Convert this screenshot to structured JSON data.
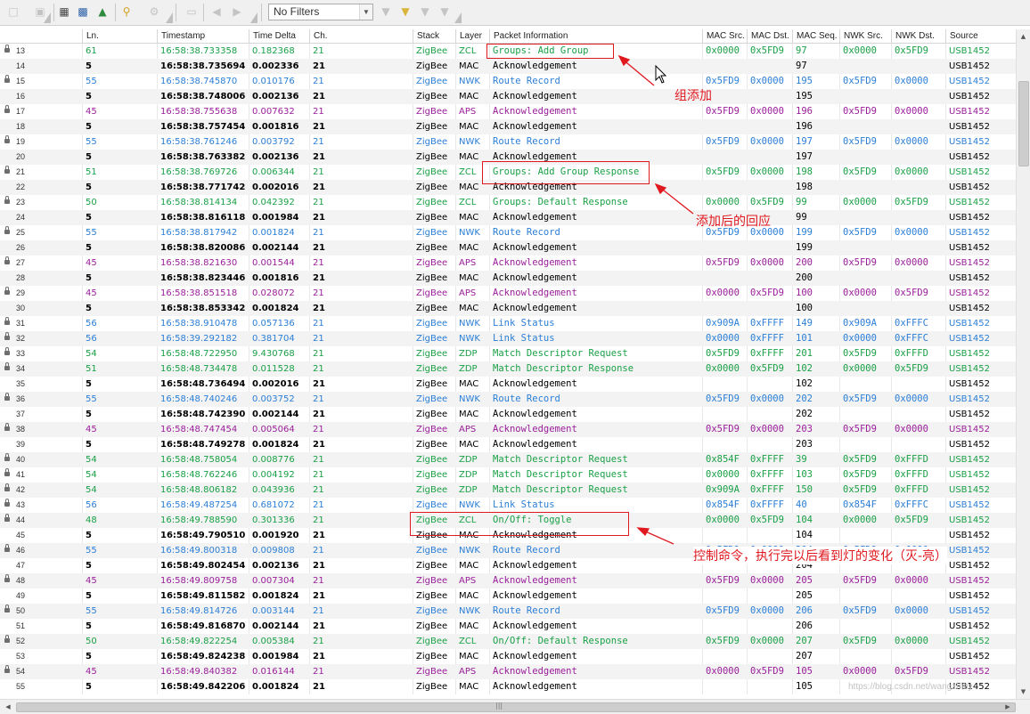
{
  "toolbar": {
    "filter_value": "No Filters",
    "icons": [
      "new-capture-icon",
      "save-icon",
      "device-list-icon",
      "capture-icon",
      "export-icon",
      "decryption-key-icon",
      "settings-gear-icon",
      "clear-icon",
      "go-back-icon",
      "go-forward-icon",
      "filter-icon",
      "filter-apply-icon",
      "filter-clear-icon",
      "filter-options-icon"
    ]
  },
  "columns": [
    "Ln.",
    "Timestamp",
    "Time Delta",
    "Ch.",
    "Stack",
    "Layer",
    "Packet Information",
    "MAC Src.",
    "MAC Dst.",
    "MAC Seq.",
    "NWK Src.",
    "NWK Dst.",
    "Source"
  ],
  "colors": {
    "green": "#1aa046",
    "blue": "#2b7ed6",
    "purple": "#9a1e9a",
    "black": "#000000",
    "annotation_red": "#e0191f",
    "odd_row": "#f3f3f3"
  },
  "packets": [
    {
      "seq": "13",
      "lock": true,
      "color": "green",
      "ln": "61",
      "ts": "16:58:38.733358",
      "delta": "0.182368",
      "ch": "21",
      "stack": "ZigBee",
      "layer": "ZCL",
      "info": "Groups: Add Group",
      "mac_src": "0x0000",
      "mac_dst": "0x5FD9",
      "mac_seq": "97",
      "nwk_src": "0x0000",
      "nwk_dst": "0x5FD9",
      "source": "USB1452"
    },
    {
      "seq": "14",
      "lock": false,
      "color": "black",
      "ln": "5",
      "ts": "16:58:38.735694",
      "delta": "0.002336",
      "ch": "21",
      "stack": "ZigBee",
      "layer": "MAC",
      "info": "Acknowledgement",
      "mac_src": "",
      "mac_dst": "",
      "mac_seq": "97",
      "nwk_src": "",
      "nwk_dst": "",
      "source": "USB1452"
    },
    {
      "seq": "15",
      "lock": true,
      "color": "blue",
      "ln": "55",
      "ts": "16:58:38.745870",
      "delta": "0.010176",
      "ch": "21",
      "stack": "ZigBee",
      "layer": "NWK",
      "info": "Route Record",
      "mac_src": "0x5FD9",
      "mac_dst": "0x0000",
      "mac_seq": "195",
      "nwk_src": "0x5FD9",
      "nwk_dst": "0x0000",
      "source": "USB1452"
    },
    {
      "seq": "16",
      "lock": false,
      "color": "black",
      "ln": "5",
      "ts": "16:58:38.748006",
      "delta": "0.002136",
      "ch": "21",
      "stack": "ZigBee",
      "layer": "MAC",
      "info": "Acknowledgement",
      "mac_src": "",
      "mac_dst": "",
      "mac_seq": "195",
      "nwk_src": "",
      "nwk_dst": "",
      "source": "USB1452"
    },
    {
      "seq": "17",
      "lock": true,
      "color": "purple",
      "ln": "45",
      "ts": "16:58:38.755638",
      "delta": "0.007632",
      "ch": "21",
      "stack": "ZigBee",
      "layer": "APS",
      "info": "Acknowledgement",
      "mac_src": "0x5FD9",
      "mac_dst": "0x0000",
      "mac_seq": "196",
      "nwk_src": "0x5FD9",
      "nwk_dst": "0x0000",
      "source": "USB1452"
    },
    {
      "seq": "18",
      "lock": false,
      "color": "black",
      "ln": "5",
      "ts": "16:58:38.757454",
      "delta": "0.001816",
      "ch": "21",
      "stack": "ZigBee",
      "layer": "MAC",
      "info": "Acknowledgement",
      "mac_src": "",
      "mac_dst": "",
      "mac_seq": "196",
      "nwk_src": "",
      "nwk_dst": "",
      "source": "USB1452"
    },
    {
      "seq": "19",
      "lock": true,
      "color": "blue",
      "ln": "55",
      "ts": "16:58:38.761246",
      "delta": "0.003792",
      "ch": "21",
      "stack": "ZigBee",
      "layer": "NWK",
      "info": "Route Record",
      "mac_src": "0x5FD9",
      "mac_dst": "0x0000",
      "mac_seq": "197",
      "nwk_src": "0x5FD9",
      "nwk_dst": "0x0000",
      "source": "USB1452"
    },
    {
      "seq": "20",
      "lock": false,
      "color": "black",
      "ln": "5",
      "ts": "16:58:38.763382",
      "delta": "0.002136",
      "ch": "21",
      "stack": "ZigBee",
      "layer": "MAC",
      "info": "Acknowledgement",
      "mac_src": "",
      "mac_dst": "",
      "mac_seq": "197",
      "nwk_src": "",
      "nwk_dst": "",
      "source": "USB1452"
    },
    {
      "seq": "21",
      "lock": true,
      "color": "green",
      "ln": "51",
      "ts": "16:58:38.769726",
      "delta": "0.006344",
      "ch": "21",
      "stack": "ZigBee",
      "layer": "ZCL",
      "info": "Groups: Add Group Response",
      "mac_src": "0x5FD9",
      "mac_dst": "0x0000",
      "mac_seq": "198",
      "nwk_src": "0x5FD9",
      "nwk_dst": "0x0000",
      "source": "USB1452"
    },
    {
      "seq": "22",
      "lock": false,
      "color": "black",
      "ln": "5",
      "ts": "16:58:38.771742",
      "delta": "0.002016",
      "ch": "21",
      "stack": "ZigBee",
      "layer": "MAC",
      "info": "Acknowledgement",
      "mac_src": "",
      "mac_dst": "",
      "mac_seq": "198",
      "nwk_src": "",
      "nwk_dst": "",
      "source": "USB1452"
    },
    {
      "seq": "23",
      "lock": true,
      "color": "green",
      "ln": "50",
      "ts": "16:58:38.814134",
      "delta": "0.042392",
      "ch": "21",
      "stack": "ZigBee",
      "layer": "ZCL",
      "info": "Groups: Default Response",
      "mac_src": "0x0000",
      "mac_dst": "0x5FD9",
      "mac_seq": "99",
      "nwk_src": "0x0000",
      "nwk_dst": "0x5FD9",
      "source": "USB1452"
    },
    {
      "seq": "24",
      "lock": false,
      "color": "black",
      "ln": "5",
      "ts": "16:58:38.816118",
      "delta": "0.001984",
      "ch": "21",
      "stack": "ZigBee",
      "layer": "MAC",
      "info": "Acknowledgement",
      "mac_src": "",
      "mac_dst": "",
      "mac_seq": "99",
      "nwk_src": "",
      "nwk_dst": "",
      "source": "USB1452"
    },
    {
      "seq": "25",
      "lock": true,
      "color": "blue",
      "ln": "55",
      "ts": "16:58:38.817942",
      "delta": "0.001824",
      "ch": "21",
      "stack": "ZigBee",
      "layer": "NWK",
      "info": "Route Record",
      "mac_src": "0x5FD9",
      "mac_dst": "0x0000",
      "mac_seq": "199",
      "nwk_src": "0x5FD9",
      "nwk_dst": "0x0000",
      "source": "USB1452"
    },
    {
      "seq": "26",
      "lock": false,
      "color": "black",
      "ln": "5",
      "ts": "16:58:38.820086",
      "delta": "0.002144",
      "ch": "21",
      "stack": "ZigBee",
      "layer": "MAC",
      "info": "Acknowledgement",
      "mac_src": "",
      "mac_dst": "",
      "mac_seq": "199",
      "nwk_src": "",
      "nwk_dst": "",
      "source": "USB1452"
    },
    {
      "seq": "27",
      "lock": true,
      "color": "purple",
      "ln": "45",
      "ts": "16:58:38.821630",
      "delta": "0.001544",
      "ch": "21",
      "stack": "ZigBee",
      "layer": "APS",
      "info": "Acknowledgement",
      "mac_src": "0x5FD9",
      "mac_dst": "0x0000",
      "mac_seq": "200",
      "nwk_src": "0x5FD9",
      "nwk_dst": "0x0000",
      "source": "USB1452"
    },
    {
      "seq": "28",
      "lock": false,
      "color": "black",
      "ln": "5",
      "ts": "16:58:38.823446",
      "delta": "0.001816",
      "ch": "21",
      "stack": "ZigBee",
      "layer": "MAC",
      "info": "Acknowledgement",
      "mac_src": "",
      "mac_dst": "",
      "mac_seq": "200",
      "nwk_src": "",
      "nwk_dst": "",
      "source": "USB1452"
    },
    {
      "seq": "29",
      "lock": true,
      "color": "purple",
      "ln": "45",
      "ts": "16:58:38.851518",
      "delta": "0.028072",
      "ch": "21",
      "stack": "ZigBee",
      "layer": "APS",
      "info": "Acknowledgement",
      "mac_src": "0x0000",
      "mac_dst": "0x5FD9",
      "mac_seq": "100",
      "nwk_src": "0x0000",
      "nwk_dst": "0x5FD9",
      "source": "USB1452"
    },
    {
      "seq": "30",
      "lock": false,
      "color": "black",
      "ln": "5",
      "ts": "16:58:38.853342",
      "delta": "0.001824",
      "ch": "21",
      "stack": "ZigBee",
      "layer": "MAC",
      "info": "Acknowledgement",
      "mac_src": "",
      "mac_dst": "",
      "mac_seq": "100",
      "nwk_src": "",
      "nwk_dst": "",
      "source": "USB1452"
    },
    {
      "seq": "31",
      "lock": true,
      "color": "blue",
      "ln": "56",
      "ts": "16:58:38.910478",
      "delta": "0.057136",
      "ch": "21",
      "stack": "ZigBee",
      "layer": "NWK",
      "info": "Link Status",
      "mac_src": "0x909A",
      "mac_dst": "0xFFFF",
      "mac_seq": "149",
      "nwk_src": "0x909A",
      "nwk_dst": "0xFFFC",
      "source": "USB1452"
    },
    {
      "seq": "32",
      "lock": true,
      "color": "blue",
      "ln": "56",
      "ts": "16:58:39.292182",
      "delta": "0.381704",
      "ch": "21",
      "stack": "ZigBee",
      "layer": "NWK",
      "info": "Link Status",
      "mac_src": "0x0000",
      "mac_dst": "0xFFFF",
      "mac_seq": "101",
      "nwk_src": "0x0000",
      "nwk_dst": "0xFFFC",
      "source": "USB1452"
    },
    {
      "seq": "33",
      "lock": true,
      "color": "green",
      "ln": "54",
      "ts": "16:58:48.722950",
      "delta": "9.430768",
      "ch": "21",
      "stack": "ZigBee",
      "layer": "ZDP",
      "info": "Match Descriptor Request",
      "mac_src": "0x5FD9",
      "mac_dst": "0xFFFF",
      "mac_seq": "201",
      "nwk_src": "0x5FD9",
      "nwk_dst": "0xFFFD",
      "source": "USB1452"
    },
    {
      "seq": "34",
      "lock": true,
      "color": "green",
      "ln": "51",
      "ts": "16:58:48.734478",
      "delta": "0.011528",
      "ch": "21",
      "stack": "ZigBee",
      "layer": "ZDP",
      "info": "Match Descriptor Response",
      "mac_src": "0x0000",
      "mac_dst": "0x5FD9",
      "mac_seq": "102",
      "nwk_src": "0x0000",
      "nwk_dst": "0x5FD9",
      "source": "USB1452"
    },
    {
      "seq": "35",
      "lock": false,
      "color": "black",
      "ln": "5",
      "ts": "16:58:48.736494",
      "delta": "0.002016",
      "ch": "21",
      "stack": "ZigBee",
      "layer": "MAC",
      "info": "Acknowledgement",
      "mac_src": "",
      "mac_dst": "",
      "mac_seq": "102",
      "nwk_src": "",
      "nwk_dst": "",
      "source": "USB1452"
    },
    {
      "seq": "36",
      "lock": true,
      "color": "blue",
      "ln": "55",
      "ts": "16:58:48.740246",
      "delta": "0.003752",
      "ch": "21",
      "stack": "ZigBee",
      "layer": "NWK",
      "info": "Route Record",
      "mac_src": "0x5FD9",
      "mac_dst": "0x0000",
      "mac_seq": "202",
      "nwk_src": "0x5FD9",
      "nwk_dst": "0x0000",
      "source": "USB1452"
    },
    {
      "seq": "37",
      "lock": false,
      "color": "black",
      "ln": "5",
      "ts": "16:58:48.742390",
      "delta": "0.002144",
      "ch": "21",
      "stack": "ZigBee",
      "layer": "MAC",
      "info": "Acknowledgement",
      "mac_src": "",
      "mac_dst": "",
      "mac_seq": "202",
      "nwk_src": "",
      "nwk_dst": "",
      "source": "USB1452"
    },
    {
      "seq": "38",
      "lock": true,
      "color": "purple",
      "ln": "45",
      "ts": "16:58:48.747454",
      "delta": "0.005064",
      "ch": "21",
      "stack": "ZigBee",
      "layer": "APS",
      "info": "Acknowledgement",
      "mac_src": "0x5FD9",
      "mac_dst": "0x0000",
      "mac_seq": "203",
      "nwk_src": "0x5FD9",
      "nwk_dst": "0x0000",
      "source": "USB1452"
    },
    {
      "seq": "39",
      "lock": false,
      "color": "black",
      "ln": "5",
      "ts": "16:58:48.749278",
      "delta": "0.001824",
      "ch": "21",
      "stack": "ZigBee",
      "layer": "MAC",
      "info": "Acknowledgement",
      "mac_src": "",
      "mac_dst": "",
      "mac_seq": "203",
      "nwk_src": "",
      "nwk_dst": "",
      "source": "USB1452"
    },
    {
      "seq": "40",
      "lock": true,
      "color": "green",
      "ln": "54",
      "ts": "16:58:48.758054",
      "delta": "0.008776",
      "ch": "21",
      "stack": "ZigBee",
      "layer": "ZDP",
      "info": "Match Descriptor Request",
      "mac_src": "0x854F",
      "mac_dst": "0xFFFF",
      "mac_seq": "39",
      "nwk_src": "0x5FD9",
      "nwk_dst": "0xFFFD",
      "source": "USB1452"
    },
    {
      "seq": "41",
      "lock": true,
      "color": "green",
      "ln": "54",
      "ts": "16:58:48.762246",
      "delta": "0.004192",
      "ch": "21",
      "stack": "ZigBee",
      "layer": "ZDP",
      "info": "Match Descriptor Request",
      "mac_src": "0x0000",
      "mac_dst": "0xFFFF",
      "mac_seq": "103",
      "nwk_src": "0x5FD9",
      "nwk_dst": "0xFFFD",
      "source": "USB1452"
    },
    {
      "seq": "42",
      "lock": true,
      "color": "green",
      "ln": "54",
      "ts": "16:58:48.806182",
      "delta": "0.043936",
      "ch": "21",
      "stack": "ZigBee",
      "layer": "ZDP",
      "info": "Match Descriptor Request",
      "mac_src": "0x909A",
      "mac_dst": "0xFFFF",
      "mac_seq": "150",
      "nwk_src": "0x5FD9",
      "nwk_dst": "0xFFFD",
      "source": "USB1452"
    },
    {
      "seq": "43",
      "lock": true,
      "color": "blue",
      "ln": "56",
      "ts": "16:58:49.487254",
      "delta": "0.681072",
      "ch": "21",
      "stack": "ZigBee",
      "layer": "NWK",
      "info": "Link Status",
      "mac_src": "0x854F",
      "mac_dst": "0xFFFF",
      "mac_seq": "40",
      "nwk_src": "0x854F",
      "nwk_dst": "0xFFFC",
      "source": "USB1452"
    },
    {
      "seq": "44",
      "lock": true,
      "color": "green",
      "ln": "48",
      "ts": "16:58:49.788590",
      "delta": "0.301336",
      "ch": "21",
      "stack": "ZigBee",
      "layer": "ZCL",
      "info": "On/Off: Toggle",
      "mac_src": "0x0000",
      "mac_dst": "0x5FD9",
      "mac_seq": "104",
      "nwk_src": "0x0000",
      "nwk_dst": "0x5FD9",
      "source": "USB1452"
    },
    {
      "seq": "45",
      "lock": false,
      "color": "black",
      "ln": "5",
      "ts": "16:58:49.790510",
      "delta": "0.001920",
      "ch": "21",
      "stack": "ZigBee",
      "layer": "MAC",
      "info": "Acknowledgement",
      "mac_src": "",
      "mac_dst": "",
      "mac_seq": "104",
      "nwk_src": "",
      "nwk_dst": "",
      "source": "USB1452"
    },
    {
      "seq": "46",
      "lock": true,
      "color": "blue",
      "ln": "55",
      "ts": "16:58:49.800318",
      "delta": "0.009808",
      "ch": "21",
      "stack": "ZigBee",
      "layer": "NWK",
      "info": "Route Record",
      "mac_src": "0x5FD9",
      "mac_dst": "0x0000",
      "mac_seq": "204",
      "nwk_src": "0x5FD9",
      "nwk_dst": "0x0000",
      "source": "USB1452"
    },
    {
      "seq": "47",
      "lock": false,
      "color": "black",
      "ln": "5",
      "ts": "16:58:49.802454",
      "delta": "0.002136",
      "ch": "21",
      "stack": "ZigBee",
      "layer": "MAC",
      "info": "Acknowledgement",
      "mac_src": "",
      "mac_dst": "",
      "mac_seq": "204",
      "nwk_src": "",
      "nwk_dst": "",
      "source": "USB1452"
    },
    {
      "seq": "48",
      "lock": true,
      "color": "purple",
      "ln": "45",
      "ts": "16:58:49.809758",
      "delta": "0.007304",
      "ch": "21",
      "stack": "ZigBee",
      "layer": "APS",
      "info": "Acknowledgement",
      "mac_src": "0x5FD9",
      "mac_dst": "0x0000",
      "mac_seq": "205",
      "nwk_src": "0x5FD9",
      "nwk_dst": "0x0000",
      "source": "USB1452"
    },
    {
      "seq": "49",
      "lock": false,
      "color": "black",
      "ln": "5",
      "ts": "16:58:49.811582",
      "delta": "0.001824",
      "ch": "21",
      "stack": "ZigBee",
      "layer": "MAC",
      "info": "Acknowledgement",
      "mac_src": "",
      "mac_dst": "",
      "mac_seq": "205",
      "nwk_src": "",
      "nwk_dst": "",
      "source": "USB1452"
    },
    {
      "seq": "50",
      "lock": true,
      "color": "blue",
      "ln": "55",
      "ts": "16:58:49.814726",
      "delta": "0.003144",
      "ch": "21",
      "stack": "ZigBee",
      "layer": "NWK",
      "info": "Route Record",
      "mac_src": "0x5FD9",
      "mac_dst": "0x0000",
      "mac_seq": "206",
      "nwk_src": "0x5FD9",
      "nwk_dst": "0x0000",
      "source": "USB1452"
    },
    {
      "seq": "51",
      "lock": false,
      "color": "black",
      "ln": "5",
      "ts": "16:58:49.816870",
      "delta": "0.002144",
      "ch": "21",
      "stack": "ZigBee",
      "layer": "MAC",
      "info": "Acknowledgement",
      "mac_src": "",
      "mac_dst": "",
      "mac_seq": "206",
      "nwk_src": "",
      "nwk_dst": "",
      "source": "USB1452"
    },
    {
      "seq": "52",
      "lock": true,
      "color": "green",
      "ln": "50",
      "ts": "16:58:49.822254",
      "delta": "0.005384",
      "ch": "21",
      "stack": "ZigBee",
      "layer": "ZCL",
      "info": "On/Off: Default Response",
      "mac_src": "0x5FD9",
      "mac_dst": "0x0000",
      "mac_seq": "207",
      "nwk_src": "0x5FD9",
      "nwk_dst": "0x0000",
      "source": "USB1452"
    },
    {
      "seq": "53",
      "lock": false,
      "color": "black",
      "ln": "5",
      "ts": "16:58:49.824238",
      "delta": "0.001984",
      "ch": "21",
      "stack": "ZigBee",
      "layer": "MAC",
      "info": "Acknowledgement",
      "mac_src": "",
      "mac_dst": "",
      "mac_seq": "207",
      "nwk_src": "",
      "nwk_dst": "",
      "source": "USB1452"
    },
    {
      "seq": "54",
      "lock": true,
      "color": "purple",
      "ln": "45",
      "ts": "16:58:49.840382",
      "delta": "0.016144",
      "ch": "21",
      "stack": "ZigBee",
      "layer": "APS",
      "info": "Acknowledgement",
      "mac_src": "0x0000",
      "mac_dst": "0x5FD9",
      "mac_seq": "105",
      "nwk_src": "0x0000",
      "nwk_dst": "0x5FD9",
      "source": "USB1452"
    },
    {
      "seq": "55",
      "lock": false,
      "color": "black",
      "ln": "5",
      "ts": "16:58:49.842206",
      "delta": "0.001824",
      "ch": "21",
      "stack": "ZigBee",
      "layer": "MAC",
      "info": "Acknowledgement",
      "mac_src": "",
      "mac_dst": "",
      "mac_seq": "105",
      "nwk_src": "",
      "nwk_dst": "",
      "source": "USB1452"
    }
  ],
  "annotations": {
    "group_add": "组添加",
    "add_response": "添加后的回应",
    "control_command": "控制命令，执行完以后看到灯的变化（灭-亮）"
  },
  "watermark": "https://blog.csdn.net/wangzhiby"
}
